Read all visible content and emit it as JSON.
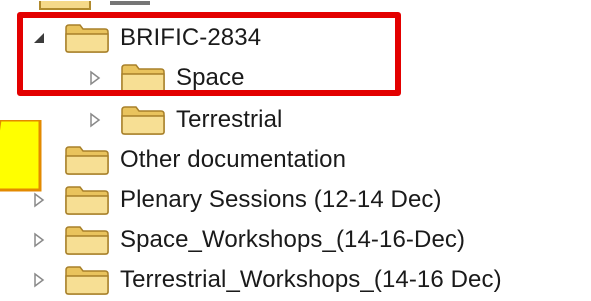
{
  "tree": {
    "partial_top_label": "...",
    "items": [
      {
        "label": "BRIFIC-2834",
        "state": "expanded"
      },
      {
        "label": "Space",
        "state": "collapsed"
      },
      {
        "label": "Terrestrial",
        "state": "collapsed"
      },
      {
        "label": "Other documentation",
        "state": "leaf"
      },
      {
        "label": "Plenary Sessions (12-14 Dec)",
        "state": "collapsed"
      },
      {
        "label": "Space_Workshops_(14-16-Dec)",
        "state": "collapsed"
      },
      {
        "label": "Terrestrial_Workshops_(14-16 Dec)",
        "state": "collapsed"
      }
    ]
  },
  "colors": {
    "highlight": "#e30000",
    "arrow_fill": "#ffff00",
    "arrow_outline": "#e38a00",
    "folder_fill": "#f5d98a",
    "folder_outline": "#b08a2e"
  },
  "icons": {
    "folder": "folder-icon",
    "collapsed": "expand-triangle-icon",
    "expanded": "collapse-triangle-icon",
    "arrow": "yellow-arrow-icon"
  }
}
